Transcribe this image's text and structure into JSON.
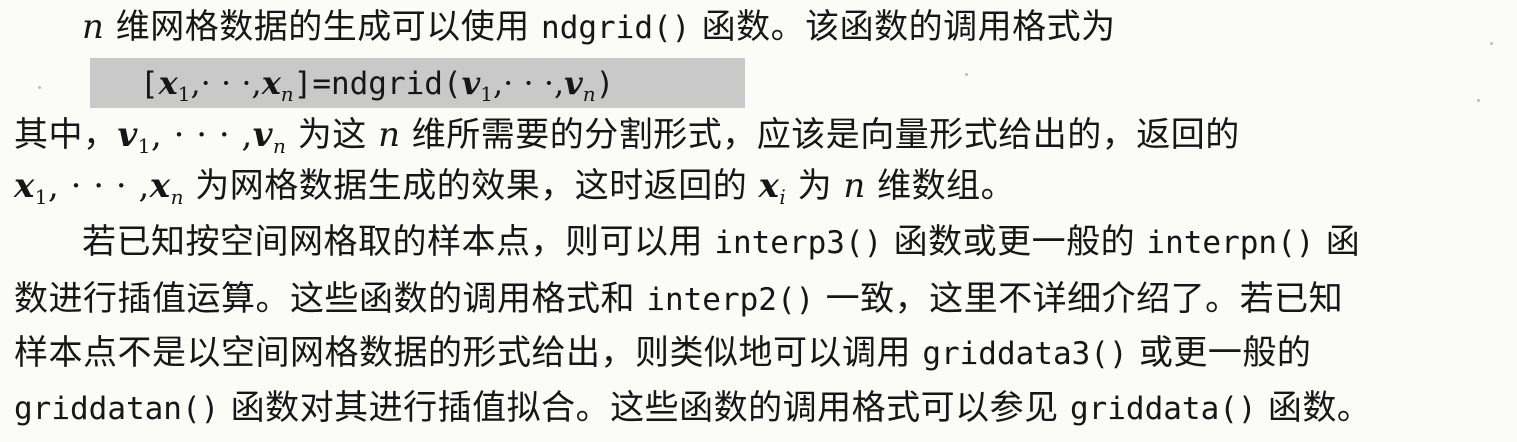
{
  "document": {
    "l1": {
      "n": "n",
      "text_a": " 维网格数据的生成可以使用 ",
      "code": "ndgrid()",
      "text_b": " 函数。该函数的调用格式为"
    },
    "formula": {
      "lbracket": "[",
      "x": "x",
      "one": "1",
      "dots": ",· · ·,",
      "n": "n",
      "eq_call": "]=ndgrid(",
      "v": "v",
      "close": ")"
    },
    "l2": {
      "text_a": "其中，",
      "v": "v",
      "one": "1",
      "dots": ", · · · ,",
      "n": "n",
      "text_b": " 为这 ",
      "n2": "n",
      "text_c": " 维所需要的分割形式，应该是向量形式给出的，返回的"
    },
    "l3": {
      "x": "x",
      "one": "1",
      "dots": ", · · · ,",
      "n": "n",
      "text_a": " 为网格数据生成的效果，这时返回的 ",
      "xi": "x",
      "i": "i",
      "text_b": " 为 ",
      "n2": "n",
      "text_c": " 维数组。"
    },
    "l4": {
      "text_a": "若已知按空间网格取的样本点，则可以用 ",
      "code_a": "interp3()",
      "text_b": " 函数或更一般的 ",
      "code_b": "interpn()",
      "text_c": " 函"
    },
    "l5": {
      "text_a": "数进行插值运算。这些函数的调用格式和 ",
      "code": "interp2()",
      "text_b": " 一致，这里不详细介绍了。若已知"
    },
    "l6": {
      "text_a": "样本点不是以空间网格数据的形式给出，则类似地可以调用 ",
      "code": "griddata3()",
      "text_b": " 或更一般的"
    },
    "l7": {
      "code_a": "griddatan()",
      "text_a": " 函数对其进行插值拟合。这些函数的调用格式可以参见 ",
      "code_b": "griddata()",
      "text_b": " 函数。"
    }
  },
  "colors": {
    "text": "#161616",
    "formula_background": "#c9c9c9",
    "page_background": "#fbfbf8"
  }
}
